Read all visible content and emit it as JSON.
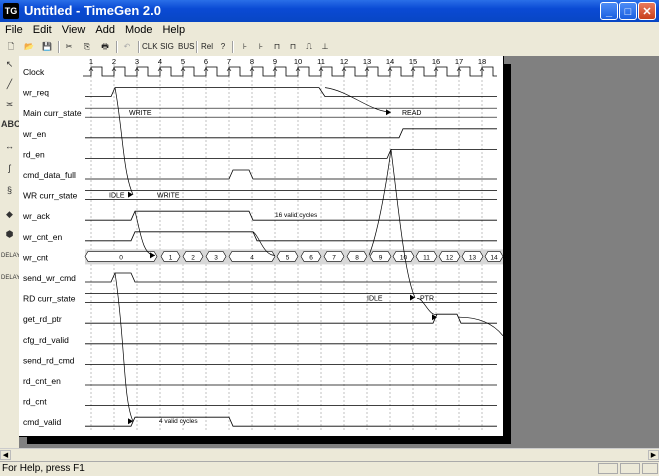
{
  "window": {
    "title": "Untitled - TimeGen 2.0",
    "icon": "timegen-app-icon"
  },
  "menu": [
    "File",
    "Edit",
    "View",
    "Add",
    "Mode",
    "Help"
  ],
  "toolbar": {
    "clk_label": "CLK",
    "sig_label": "SIG",
    "bus_label": "BUS",
    "rel_label": "Rel",
    "text_label": "?",
    "clk_lbls": [
      "CLK",
      "CLK",
      "CLK",
      "CLK"
    ]
  },
  "left_tools": {
    "text_tool": "ABC",
    "delay_label": "DELAY"
  },
  "diagram": {
    "clock_numbers": [
      "1",
      "2",
      "3",
      "4",
      "5",
      "6",
      "7",
      "8",
      "9",
      "10",
      "11",
      "12",
      "13",
      "14",
      "15",
      "16",
      "17",
      "18"
    ],
    "signals": [
      "Clock",
      "wr_req",
      "Main curr_state",
      "wr_en",
      "rd_en",
      "cmd_data_full",
      "WR curr_state",
      "wr_ack",
      "wr_cnt_en",
      "wr_cnt",
      "send_wr_cmd",
      "RD curr_state",
      "get_rd_ptr",
      "cfg_rd_valid",
      "send_rd_cmd",
      "rd_cnt_en",
      "rd_cnt",
      "cmd_valid"
    ],
    "main_state": {
      "s1": "WRITE",
      "s2": "READ"
    },
    "wr_state": {
      "s1": "IDLE",
      "s2": "WRITE"
    },
    "rd_state": {
      "s1": "IDLE",
      "s2": "PTR"
    },
    "wr_cnt_values": [
      "0",
      "1",
      "2",
      "3",
      "4",
      "5",
      "6",
      "7",
      "8",
      "9",
      "10",
      "11",
      "12",
      "13",
      "14"
    ],
    "annotation_ack": "16 valid cycles",
    "annotation_cmd": "4 valid cycles"
  },
  "status": {
    "help": "For Help, press F1"
  }
}
